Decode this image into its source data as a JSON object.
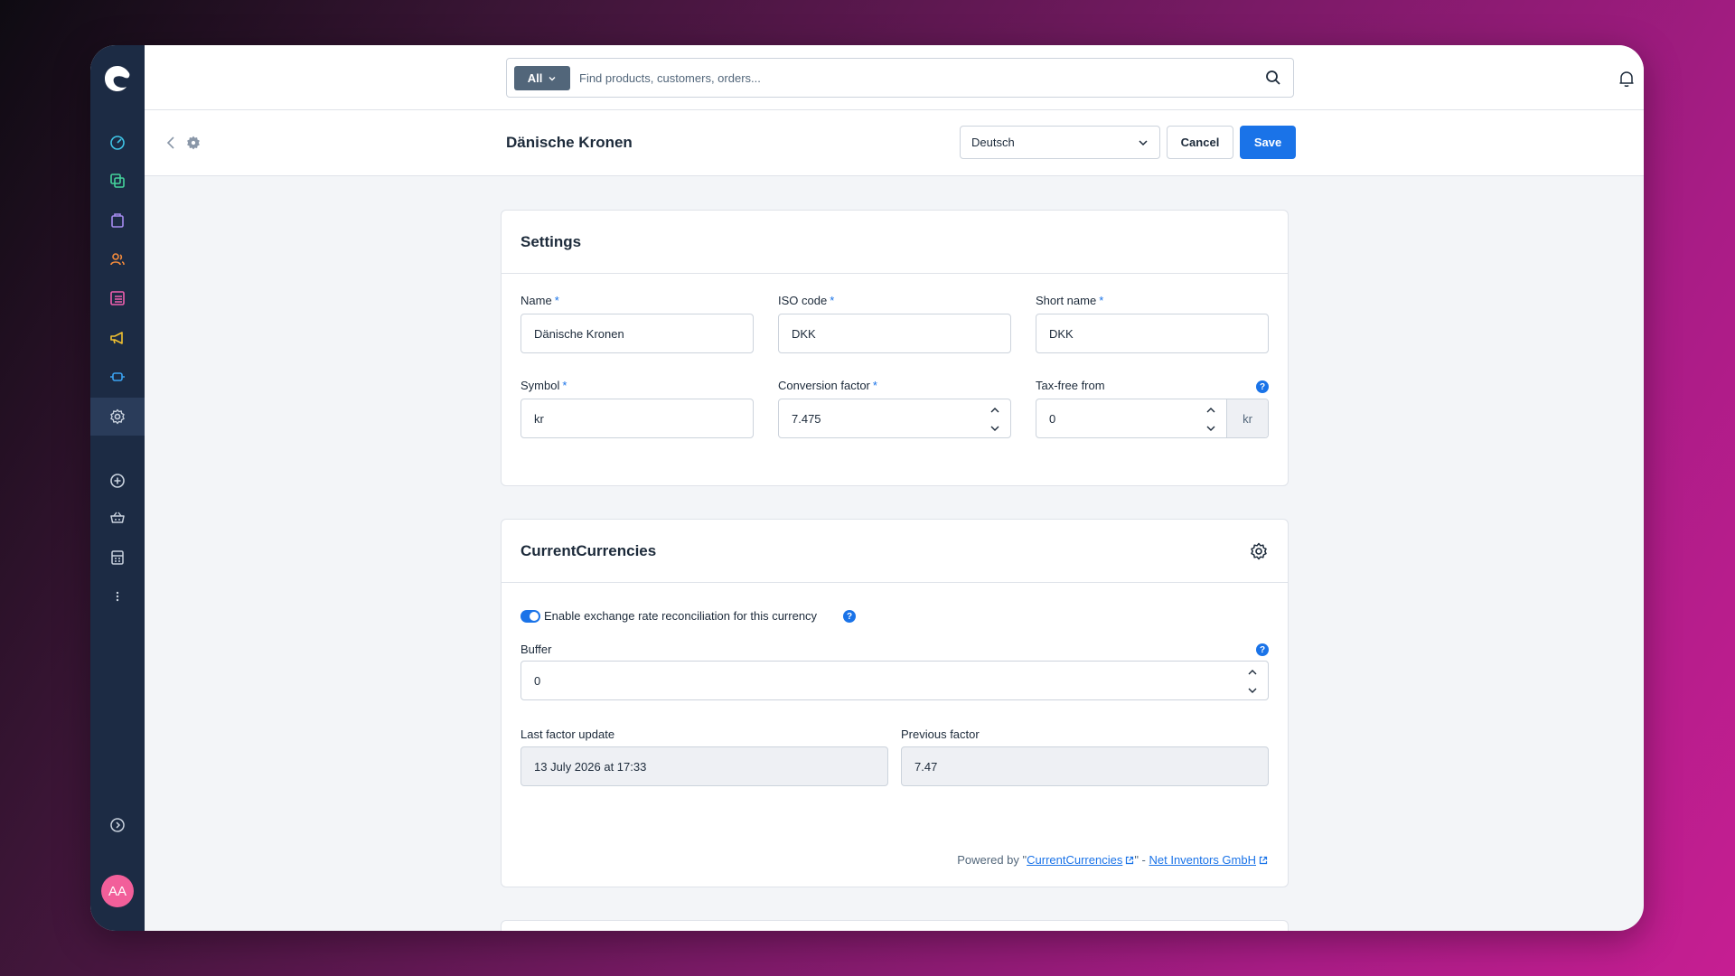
{
  "colors": {
    "accent": "#1a73e8",
    "sidebar": "#1c2b44",
    "avatar": "#f25f9a"
  },
  "sidebar": {
    "items": [
      {
        "icon": "dashboard-icon"
      },
      {
        "icon": "catalog-icon"
      },
      {
        "icon": "orders-icon"
      },
      {
        "icon": "customers-icon"
      },
      {
        "icon": "content-icon"
      },
      {
        "icon": "marketing-icon"
      },
      {
        "icon": "extensions-icon"
      },
      {
        "icon": "settings-icon",
        "active": true
      },
      {
        "icon": "add-sales-channel-icon"
      },
      {
        "icon": "storefront-icon"
      },
      {
        "icon": "pos-icon"
      },
      {
        "icon": "more-icon"
      },
      {
        "icon": "collapse-icon"
      }
    ],
    "avatar": "AA"
  },
  "topbar": {
    "search_type": "All",
    "search_placeholder": "Find products, customers, orders..."
  },
  "header": {
    "title": "Dänische Kronen",
    "language": "Deutsch",
    "cancel_label": "Cancel",
    "save_label": "Save"
  },
  "settings": {
    "title": "Settings",
    "name_label": "Name",
    "name_value": "Dänische Kronen",
    "iso_label": "ISO code",
    "iso_value": "DKK",
    "short_label": "Short name",
    "short_value": "DKK",
    "symbol_label": "Symbol",
    "symbol_value": "kr",
    "factor_label": "Conversion factor",
    "factor_value": "7.475",
    "taxfree_label": "Tax-free from",
    "taxfree_value": "0",
    "taxfree_suffix": "kr",
    "required_mark": "*",
    "help_mark": "?"
  },
  "currencies": {
    "title": "CurrentCurrencies",
    "toggle_label": "Enable exchange rate reconciliation for this currency",
    "toggle_on": true,
    "buffer_label": "Buffer",
    "buffer_value": "0",
    "last_update_label": "Last factor update",
    "last_update_value": "13 July 2026 at 17:33",
    "prev_factor_label": "Previous factor",
    "prev_factor_value": "7.47",
    "powered_prefix": "Powered by \"",
    "powered_link1": "CurrentCurrencies",
    "powered_sep": "\" - ",
    "powered_link2": "Net Inventors GmbH"
  }
}
